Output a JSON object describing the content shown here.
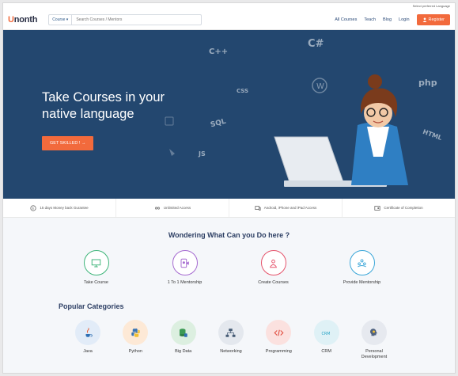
{
  "top_bar": {
    "language_text": "Select preferred Language"
  },
  "header": {
    "logo": {
      "first_letter": "U",
      "rest": "nonth"
    },
    "search": {
      "category_label": "Course ▾",
      "placeholder": "Search Courses / Mentors"
    },
    "nav": {
      "all_courses": "All Courses",
      "teach": "Teach",
      "blog": "Blog",
      "login": "Login"
    },
    "register_label": "Register"
  },
  "hero": {
    "title": "Take Courses in your native language",
    "cta_label": "GET SKILLED ! →",
    "tech_words": [
      "C++",
      "C#",
      "CSS",
      "php",
      "SQL",
      "JS",
      "HTML"
    ]
  },
  "features": [
    {
      "label": "15 days Money back Gurantee",
      "icon": "money-back-icon"
    },
    {
      "label": "Unlimited Access",
      "icon": "infinity-icon"
    },
    {
      "label": "Android, iPhone and iPad Access",
      "icon": "devices-icon"
    },
    {
      "label": "Certificate of Completion",
      "icon": "certificate-icon"
    }
  ],
  "wonder": {
    "title": "Wondering What Can you Do here ?",
    "items": [
      {
        "label": "Take Course",
        "color": "#3fb57a",
        "icon": "monitor-icon"
      },
      {
        "label": "1 To 1 Mentorship",
        "color": "#a56ad0",
        "icon": "video-call-icon"
      },
      {
        "label": "Create Courses",
        "color": "#e5536b",
        "icon": "presenter-icon"
      },
      {
        "label": "Provide Mentorship",
        "color": "#3aa6d8",
        "icon": "group-icon"
      }
    ]
  },
  "categories": {
    "title": "Popular Categories",
    "items": [
      {
        "label": "Java",
        "bg": "#e2ecf8",
        "icon": "java-icon"
      },
      {
        "label": "Python",
        "bg": "#fde9d6",
        "icon": "python-icon"
      },
      {
        "label": "Big Data",
        "bg": "#dcefe0",
        "icon": "database-icon"
      },
      {
        "label": "Networking",
        "bg": "#e4e8ee",
        "icon": "network-icon"
      },
      {
        "label": "Programming",
        "bg": "#fbe1df",
        "icon": "code-icon"
      },
      {
        "label": "CRM",
        "bg": "#dff1f6",
        "icon": "crm-icon"
      },
      {
        "label": "Personal Development",
        "bg": "#e6e9ef",
        "icon": "brain-icon"
      }
    ]
  },
  "colors": {
    "accent": "#f26a3c",
    "hero_bg": "#23476f",
    "heading": "#2c3e63"
  }
}
